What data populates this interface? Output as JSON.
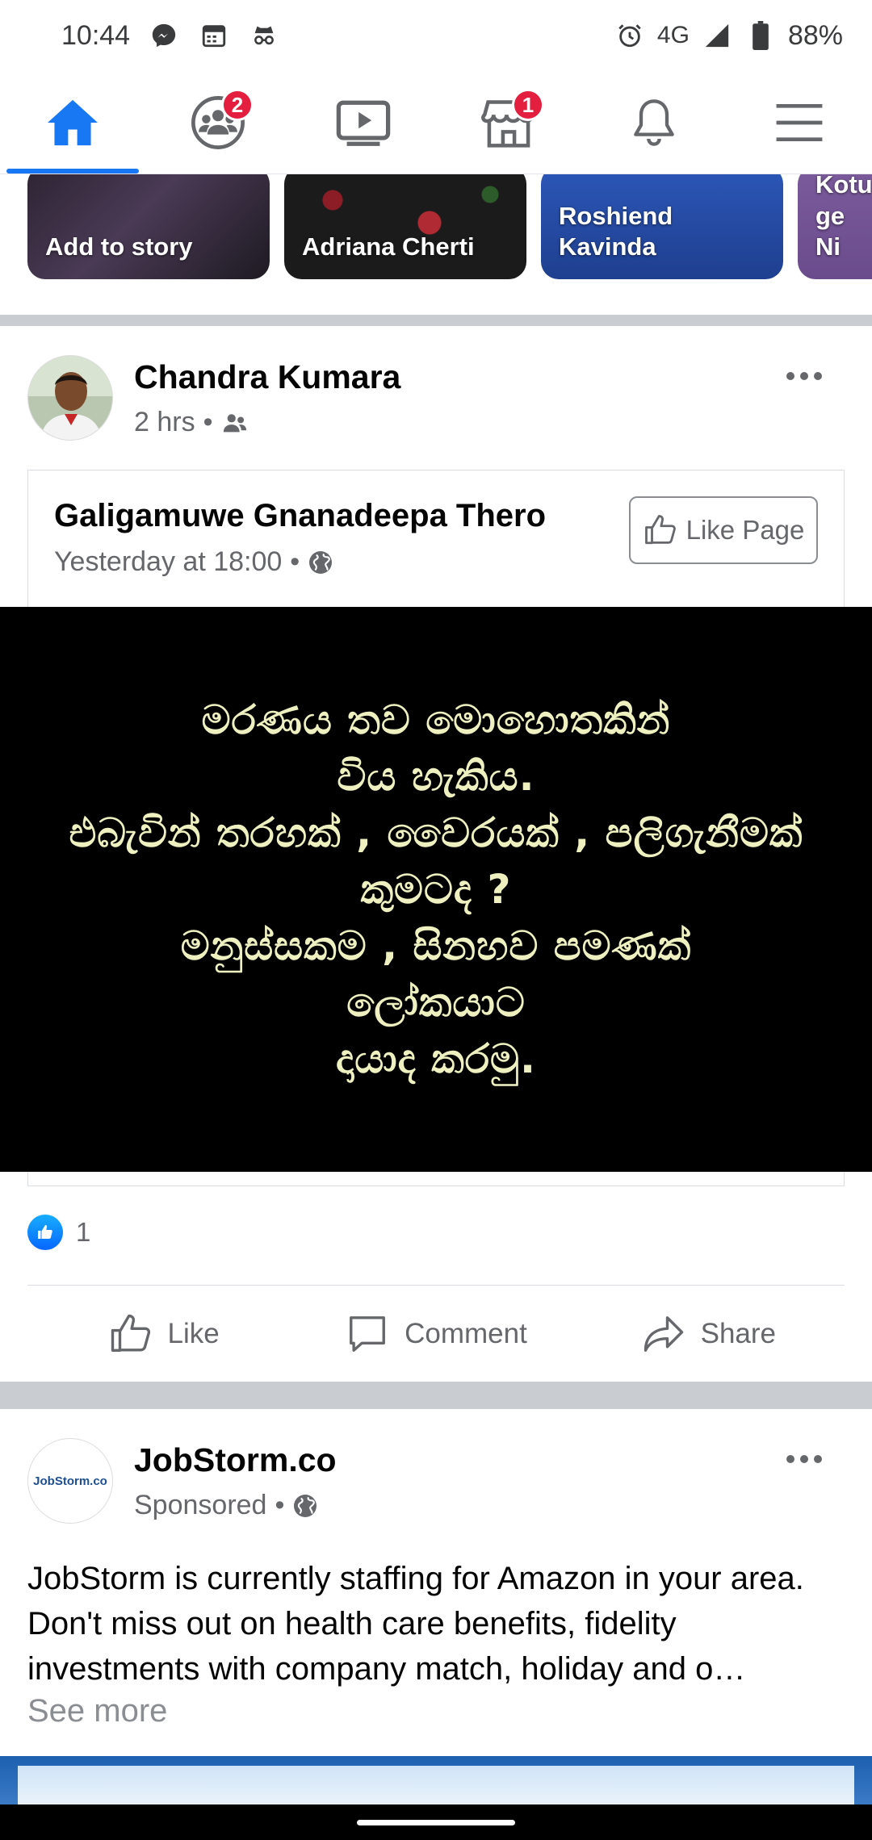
{
  "status_bar": {
    "time": "10:44",
    "network": "4G",
    "battery": "88%",
    "icons": [
      "messenger-icon",
      "calendar-icon",
      "incognito-icon",
      "alarm-icon",
      "signal-icon",
      "battery-icon"
    ]
  },
  "top_nav": {
    "tabs": [
      {
        "name": "home",
        "icon": "home-icon",
        "active": true
      },
      {
        "name": "groups",
        "icon": "groups-icon",
        "badge": "2"
      },
      {
        "name": "watch",
        "icon": "video-icon"
      },
      {
        "name": "marketplace",
        "icon": "marketplace-icon",
        "badge": "1"
      },
      {
        "name": "notifications",
        "icon": "bell-icon"
      },
      {
        "name": "menu",
        "icon": "hamburger-icon"
      }
    ],
    "accent": "#1877f2",
    "badge_color": "#e41e3f"
  },
  "stories": [
    {
      "label": "Add to story"
    },
    {
      "label": "Adriana Cherti"
    },
    {
      "label": "Roshiend Kavinda"
    },
    {
      "label": "Kotu ge Ni"
    }
  ],
  "post1": {
    "author": "Chandra Kumara",
    "time": "2 hrs",
    "audience_icon": "friends-icon",
    "shared": {
      "page_name": "Galigamuwe Gnanadeepa Thero",
      "time": "Yesterday at 18:00",
      "audience_icon": "globe-icon",
      "like_page_label": "Like Page"
    },
    "image_text": [
      "මරණය තව මොහොතකින්",
      "විය හැකිය.",
      "එබැවින් තරහක් , වෛරයක් , පලිගැනීමක්",
      "කුමටද ?",
      "මනුස්සකම , සිනහව පමණක්",
      "ලෝකයාට",
      "දායාද කරමු."
    ],
    "reaction_count": "1",
    "actions": {
      "like": "Like",
      "comment": "Comment",
      "share": "Share"
    }
  },
  "post2": {
    "author": "JobStorm.co",
    "logo_text": "JobStorm.co",
    "meta": "Sponsored",
    "audience_icon": "globe-icon",
    "caption": "JobStorm is currently staffing for Amazon in your area. Don't miss out on health care benefits, fidelity investments with company match, holiday and o…",
    "see_more": "See more"
  }
}
